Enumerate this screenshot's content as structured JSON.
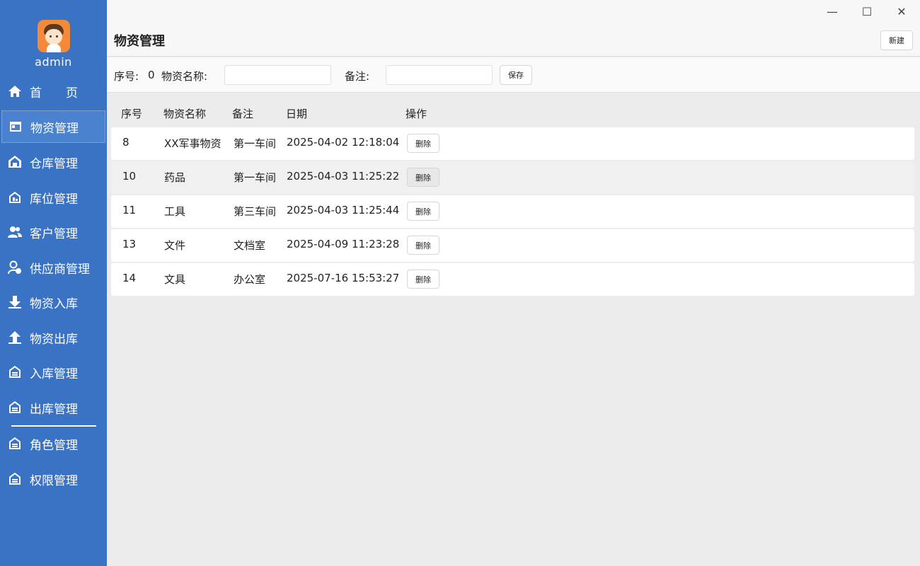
{
  "user": {
    "name": "admin"
  },
  "sidebar": {
    "items": [
      {
        "label": "首　　页",
        "icon": "home-icon",
        "active": false
      },
      {
        "label": "物资管理",
        "icon": "materials-icon",
        "active": true
      },
      {
        "label": "仓库管理",
        "icon": "warehouse-icon",
        "active": false
      },
      {
        "label": "库位管理",
        "icon": "location-icon",
        "active": false
      },
      {
        "label": "客户管理",
        "icon": "customers-icon",
        "active": false
      },
      {
        "label": "供应商管理",
        "icon": "supplier-icon",
        "active": false
      },
      {
        "label": "物资入库",
        "icon": "arrow-down-icon",
        "active": false
      },
      {
        "label": "物资出库",
        "icon": "arrow-up-icon",
        "active": false
      },
      {
        "label": "入库管理",
        "icon": "inbound-icon",
        "active": false
      },
      {
        "label": "出库管理",
        "icon": "outbound-icon",
        "active": false
      },
      {
        "label": "角色管理",
        "icon": "role-icon",
        "active": false
      },
      {
        "label": "权限管理",
        "icon": "permission-icon",
        "active": false
      }
    ]
  },
  "window_controls": {
    "minimize": "—",
    "maximize": "☐",
    "close": "✕"
  },
  "header": {
    "title": "物资管理",
    "new_label": "新建"
  },
  "form": {
    "id_label": "序号:",
    "id_value": "0",
    "name_label": "物资名称:",
    "name_value": "",
    "note_label": "备注:",
    "note_value": "",
    "save_label": "保存"
  },
  "table": {
    "columns": [
      "序号",
      "物资名称",
      "备注",
      "日期",
      "操作"
    ],
    "delete_label": "删除",
    "rows": [
      {
        "id": "8",
        "name": "XX军事物资",
        "note": "第一车间",
        "date": "2025-04-02 12:18:04"
      },
      {
        "id": "10",
        "name": "药品",
        "note": "第一车间",
        "date": "2025-04-03 11:25:22"
      },
      {
        "id": "11",
        "name": "工具",
        "note": "第三车间",
        "date": "2025-04-03 11:25:44"
      },
      {
        "id": "13",
        "name": "文件",
        "note": "文档室",
        "date": "2025-04-09 11:23:28"
      },
      {
        "id": "14",
        "name": "文具",
        "note": "办公室",
        "date": "2025-07-16 15:53:27"
      }
    ]
  },
  "colors": {
    "sidebar": "#3a72c4",
    "sidebar_active": "#4a82cf",
    "content_bg": "#ececec"
  }
}
